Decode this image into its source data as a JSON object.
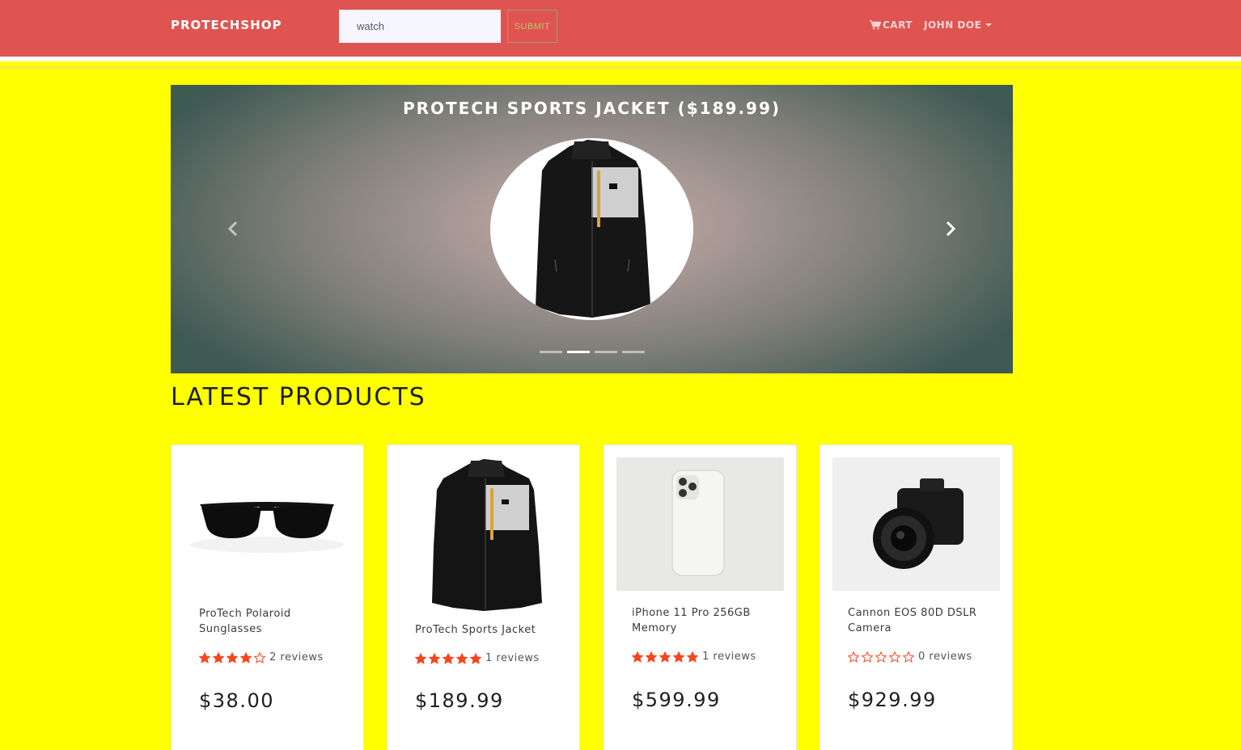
{
  "navbar": {
    "brand": "PROTECHSHOP",
    "search_value": "watch",
    "submit_label": "SUBMIT",
    "cart_label": "CART",
    "user_label": "JOHN DOE",
    "bg_color": "#df5451"
  },
  "carousel": {
    "caption": "PROTECH SPORTS JACKET ($189.99)",
    "active_index": 1,
    "indicator_count": 4
  },
  "section": {
    "title": "LATEST PRODUCTS"
  },
  "products": [
    {
      "name": "ProTech Polaroid Sunglasses",
      "rating": 4,
      "reviews_text": "2 reviews",
      "price": "$38.00",
      "icon": "sunglasses-image"
    },
    {
      "name": "ProTech Sports Jacket",
      "rating": 5,
      "reviews_text": "1 reviews",
      "price": "$189.99",
      "icon": "jacket-image"
    },
    {
      "name": "iPhone 11 Pro 256GB Memory",
      "rating": 5,
      "reviews_text": "1 reviews",
      "price": "$599.99",
      "icon": "phone-image"
    },
    {
      "name": "Cannon EOS 80D DSLR Camera",
      "rating": 0,
      "reviews_text": "0 reviews",
      "price": "$929.99",
      "icon": "camera-image"
    }
  ],
  "colors": {
    "page_bg": "#ffff00",
    "star": "#f8441c"
  }
}
